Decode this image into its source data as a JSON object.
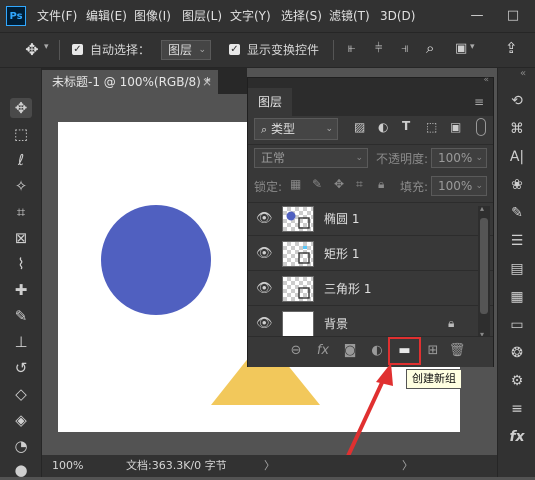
{
  "app": {
    "logo": "Ps"
  },
  "menu": [
    "文件(F)",
    "编辑(E)",
    "图像(I)",
    "图层(L)",
    "文字(Y)",
    "选择(S)",
    "滤镜(T)",
    "3D(D)"
  ],
  "window_controls": {
    "minimize": "—",
    "maximize": "□"
  },
  "options": {
    "auto_select_label": "自动选择：",
    "auto_select_target": "图层",
    "show_transform_label": "显示变换控件"
  },
  "document": {
    "tab_title": "未标题-1 @ 100%(RGB/8) *",
    "close": "×"
  },
  "status": {
    "zoom": "100%",
    "doc_info": "文档:363.3K/0 字节",
    "arrow": "〉"
  },
  "layers_panel": {
    "title": "图层",
    "filter_label": "类型",
    "blend_mode": "正常",
    "opacity_label": "不透明度:",
    "opacity_value": "100%",
    "lock_label": "锁定:",
    "fill_label": "填充:",
    "fill_value": "100%",
    "layers": [
      {
        "name": "椭圆 1",
        "type": "ellipse"
      },
      {
        "name": "矩形 1",
        "type": "rect"
      },
      {
        "name": "三角形 1",
        "type": "triangle"
      },
      {
        "name": "背景",
        "type": "background"
      }
    ],
    "tooltip": "创建新组"
  },
  "colors": {
    "circle": "#5060c0",
    "triangle": "#f2c85b",
    "highlight": "#e03030"
  }
}
